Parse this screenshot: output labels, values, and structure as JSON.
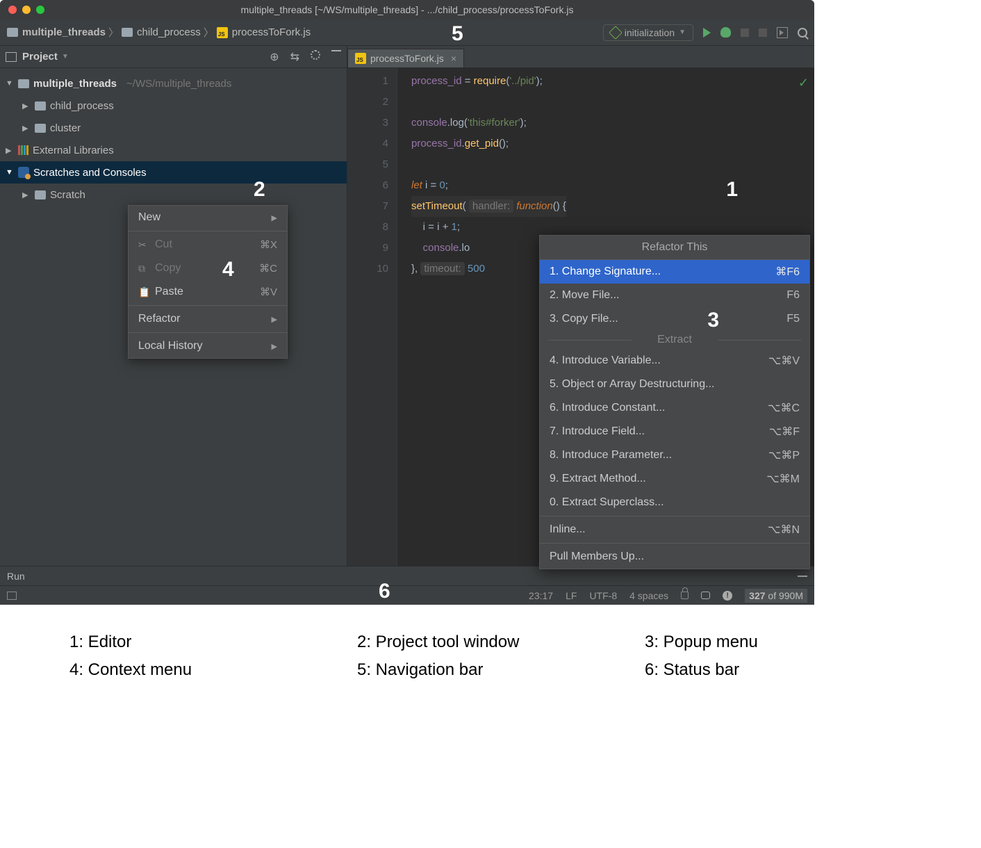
{
  "window": {
    "title": "multiple_threads [~/WS/multiple_threads] - .../child_process/processToFork.js"
  },
  "breadcrumbs": [
    {
      "icon": "folder",
      "label": "multiple_threads"
    },
    {
      "icon": "folder",
      "label": "child_process"
    },
    {
      "icon": "js",
      "label": "processToFork.js"
    }
  ],
  "run_config": {
    "label": "initialization"
  },
  "project_tool": {
    "title": "Project",
    "root": {
      "label": "multiple_threads",
      "path": "~/WS/multiple_threads"
    },
    "children": [
      {
        "label": "child_process"
      },
      {
        "label": "cluster"
      }
    ],
    "external": "External Libraries",
    "scratches": "Scratches and Consoles",
    "scratch_child": "Scratch"
  },
  "editor": {
    "tab": "processToFork.js",
    "lines": [
      "1",
      "2",
      "3",
      "4",
      "5",
      "6",
      "7",
      "8",
      "9",
      "10"
    ]
  },
  "code": {
    "l1a": "process_id",
    "l1b": " = ",
    "l1c": "require",
    "l1d": "(",
    "l1e": "'../pid'",
    "l1f": ");",
    "l3a": "console",
    "l3b": ".log(",
    "l3c": "'this#forker'",
    "l3d": ");",
    "l4a": "process_id",
    "l4b": ".",
    "l4c": "get_pid",
    "l4d": "();",
    "l6a": "let ",
    "l6b": "i = ",
    "l6c": "0",
    "l6d": ";",
    "l7a": "setTimeout",
    "l7b": "( ",
    "l7h": "handler:",
    "l7c": " function",
    "l7d": "() {",
    "l8a": "    i = i + ",
    "l8b": "1",
    "l8c": ";",
    "l9a": "    ",
    "l9b": "console",
    "l9c": ".lo",
    "l10a": "}, ",
    "l10h": "timeout:",
    "l10b": " 500"
  },
  "context_menu": {
    "new": "New",
    "cut": "Cut",
    "cut_sc": "⌘X",
    "copy": "Copy",
    "copy_sc": "⌘C",
    "paste": "Paste",
    "paste_sc": "⌘V",
    "refactor": "Refactor",
    "history": "Local History"
  },
  "popup": {
    "title": "Refactor This",
    "items": [
      {
        "label": "1. Change Signature...",
        "sc": "⌘F6",
        "sel": true
      },
      {
        "label": "2. Move File...",
        "sc": "F6"
      },
      {
        "label": "3. Copy File...",
        "sc": "F5"
      }
    ],
    "extract_title": "Extract",
    "extract": [
      {
        "label": "4. Introduce Variable...",
        "sc": "⌥⌘V"
      },
      {
        "label": "5. Object or Array Destructuring..."
      },
      {
        "label": "6. Introduce Constant...",
        "sc": "⌥⌘C"
      },
      {
        "label": "7. Introduce Field...",
        "sc": "⌥⌘F"
      },
      {
        "label": "8. Introduce Parameter...",
        "sc": "⌥⌘P"
      },
      {
        "label": "9. Extract Method...",
        "sc": "⌥⌘M"
      },
      {
        "label": "0. Extract Superclass..."
      }
    ],
    "inline": "Inline...",
    "inline_sc": "⌥⌘N",
    "pull": "Pull Members Up..."
  },
  "run_label": "Run",
  "status": {
    "pos": "23:17",
    "sep": "LF",
    "enc": "UTF-8",
    "indent": "4 spaces",
    "mem": "327",
    "mem2": " of 990M"
  },
  "callouts": {
    "c1": "1",
    "c2": "2",
    "c3": "3",
    "c4": "4",
    "c5": "5",
    "c6": "6"
  },
  "legend": {
    "l1": "1:  Editor",
    "l2": "2:  Project tool window",
    "l3": "3:  Popup menu",
    "l4": "4:  Context menu",
    "l5": "5:  Navigation bar",
    "l6": "6:  Status bar"
  }
}
